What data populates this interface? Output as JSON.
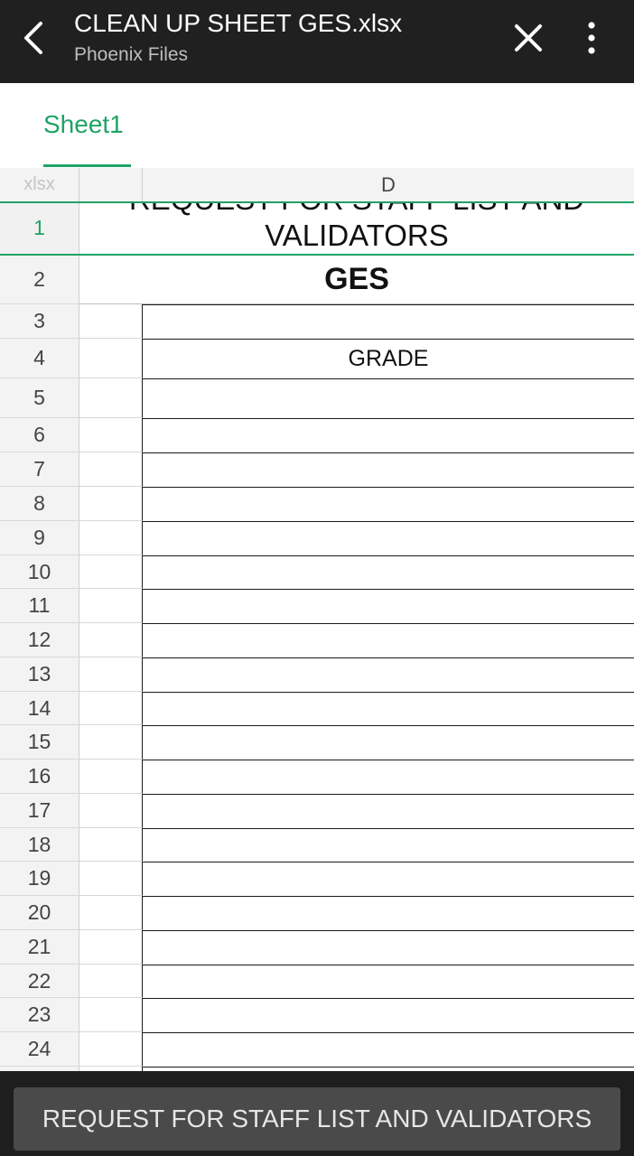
{
  "appbar": {
    "title": "CLEAN UP SHEET GES.xlsx",
    "subtitle": "Phoenix Files",
    "back_icon": "chevron-left-icon",
    "close_icon": "close-icon",
    "more_icon": "more-vertical-icon"
  },
  "tabs": [
    {
      "label": "Sheet1",
      "active": true
    }
  ],
  "grid": {
    "corner_label": "xlsx",
    "column_header": "D",
    "row_labels": [
      "1",
      "2",
      "3",
      "4",
      "5",
      "6",
      "7",
      "8",
      "9",
      "10",
      "11",
      "12",
      "13",
      "14",
      "15",
      "16",
      "17",
      "18",
      "19",
      "20",
      "21",
      "22",
      "23",
      "24"
    ],
    "selected_row": "1",
    "row1_line1": "REQUEST FOR STAFF LIST AND",
    "row1_line2": "VALIDATORS",
    "row2_text": "GES",
    "row4_d_text": "GRADE"
  },
  "cell_content": "REQUEST FOR STAFF LIST AND VALIDATORS",
  "colors": {
    "accent": "#21a366",
    "appbar_bg": "#202020",
    "bottombar_bg": "#1e1e1e",
    "field_bg": "#4a4a4a"
  }
}
